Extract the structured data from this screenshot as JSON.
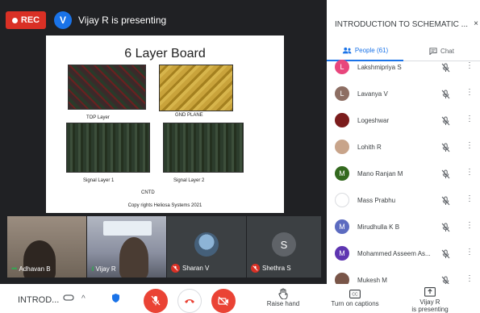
{
  "header": {
    "rec_label": "REC",
    "presenter_initial": "V",
    "presenting_text": "Vijay R is presenting"
  },
  "slide": {
    "title": "6 Layer Board",
    "labels": {
      "top_layer": "TOP Layer",
      "gnd_plane": "GND PLANE",
      "signal1": "Signal Layer 1",
      "signal2": "Signal Layer 2",
      "cntd": "CNTD",
      "copyright": "Copy rights Heliosa Systems 2021"
    }
  },
  "tiles": [
    {
      "name": "Adhavan B",
      "state": "speaking"
    },
    {
      "name": "Vijay R",
      "state": "speaking"
    },
    {
      "name": "Sharan V",
      "state": "muted"
    },
    {
      "name": "Shethra S",
      "state": "muted",
      "initial": "S"
    }
  ],
  "panel": {
    "title": "INTRODUCTION TO SCHEMATIC ...",
    "close_glyph": "×",
    "tabs": {
      "people": "People (61)",
      "chat": "Chat"
    },
    "participants": [
      {
        "name": "Lakshmipriya S",
        "initial": "L",
        "color": "#e8467c"
      },
      {
        "name": "Lavanya V",
        "initial": "L",
        "color": "#8d6e63"
      },
      {
        "name": "Logeshwar",
        "initial": "",
        "color": "#7b1c1c"
      },
      {
        "name": "Lohith R",
        "initial": "",
        "color": "#c8a48a"
      },
      {
        "name": "Mano Ranjan M",
        "initial": "M",
        "color": "#33691e"
      },
      {
        "name": "Mass Prabhu",
        "initial": "",
        "color": "#ffffff"
      },
      {
        "name": "Mirudhulla K B",
        "initial": "M",
        "color": "#5c6bc0"
      },
      {
        "name": "Mohammed Asseem As...",
        "initial": "M",
        "color": "#5e35b1"
      },
      {
        "name": "Mukesh M",
        "initial": "",
        "color": "#795548"
      }
    ],
    "more_glyph": "⋮"
  },
  "bottom_bar": {
    "meeting_name": "INTROD...",
    "chevron": "^",
    "actions": {
      "raise_hand": "Raise hand",
      "captions": "Turn on captions",
      "present_line1": "Vijay R",
      "present_line2": "is presenting"
    }
  },
  "colors": {
    "accent": "#1a73e8",
    "danger": "#ea4335",
    "rec": "#d93025"
  }
}
